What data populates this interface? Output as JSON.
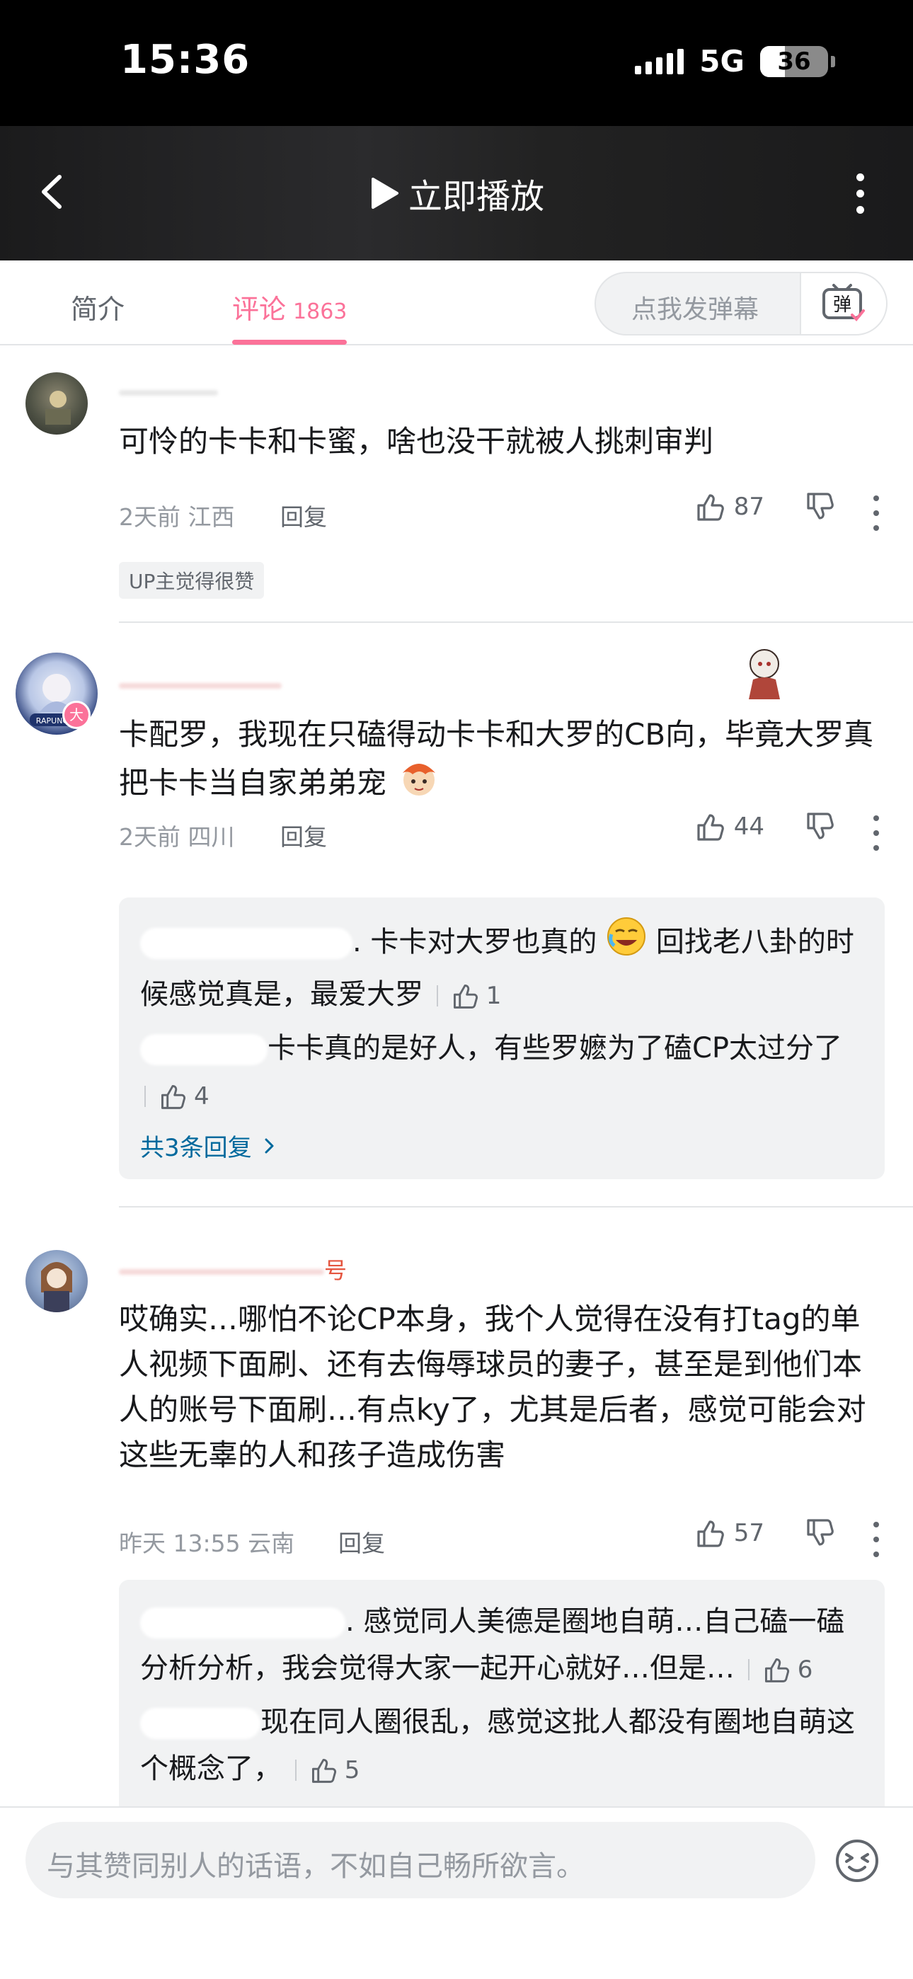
{
  "status_bar": {
    "time": "15:36",
    "network": "5G",
    "battery": "36",
    "battery_level": 0.36
  },
  "video_bar": {
    "play_label": "立即播放",
    "icons": [
      "back-arrow-icon",
      "play-icon",
      "more-vertical-icon"
    ]
  },
  "tabs": {
    "intro_label": "简介",
    "comments_label": "评论",
    "comments_count": "1863",
    "danmaku_placeholder": "点我发弹幕",
    "danmaku_button_label": "弹"
  },
  "comments": [
    {
      "text": "可怜的卡卡和卡蜜，啥也没干就被人挑刺审判",
      "time": "2天前",
      "location": "江西",
      "reply_label": "回复",
      "likes": "87",
      "badge": "UP主觉得很赞"
    },
    {
      "text": "卡配罗，我现在只磕得动卡卡和大罗的CB向，毕竟大罗真把卡卡当自家弟弟宠",
      "time": "2天前",
      "location": "四川",
      "reply_label": "回复",
      "likes": "44",
      "avatar_badge": "大",
      "avatar_caption": "RAPUNCEL",
      "replies": [
        {
          "text_a": ". 卡卡对大罗也真的",
          "text_b": "回找老八卦的时候感觉真是，最爱大罗",
          "likes": "1"
        },
        {
          "text": "卡卡真的是好人，有些罗嬷为了磕CP太过分了",
          "likes": "4"
        }
      ],
      "more_replies": "共3条回复"
    },
    {
      "text": "哎确实…哪怕不论CP本身，我个人觉得在没有打tag的单人视频下面刷、还有去侮辱球员的妻子，甚至是到他们本人的账号下面刷…有点ky了，尤其是后者，感觉可能会对这些无辜的人和孩子造成伤害",
      "time": "昨天 13:55",
      "location": "云南",
      "reply_label": "回复",
      "likes": "57",
      "name_fragment": "号",
      "replies": [
        {
          "text": ". 感觉同人美德是圈地自萌…自己磕一磕分析分析，我会觉得大家一起开心就好…但是…",
          "likes": "6"
        },
        {
          "text": "现在同人圈很乱，感觉这批人都没有圈地自萌这个概念了，",
          "likes": "5"
        }
      ]
    }
  ],
  "input_bar": {
    "placeholder": "与其赞同别人的话语，不如自己畅所欲言。",
    "icons": [
      "emoji-icon"
    ]
  },
  "colors": {
    "accent": "#fb7299",
    "link": "#00699d",
    "muted": "#9499a0"
  }
}
